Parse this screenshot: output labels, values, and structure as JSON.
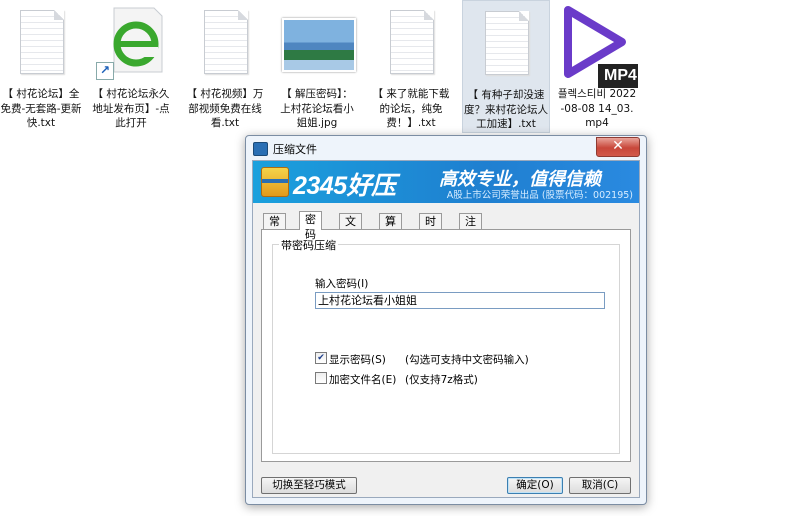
{
  "desktop": {
    "icons": [
      {
        "caption": "【 村花论坛】全免费-无套路-更新快.txt",
        "type": "text-file-icon"
      },
      {
        "caption": "【 村花论坛永久地址发布页】-点此打开",
        "type": "shortcut-ie-icon"
      },
      {
        "caption": "【 村花视频】万部视频免费在线看.txt",
        "type": "text-file-icon"
      },
      {
        "caption": "【 解压密码】：上村花论坛看小姐姐.jpg",
        "type": "image-file-icon"
      },
      {
        "caption": "【 来了就能下载的论坛，纯免费！】.txt",
        "type": "text-file-icon"
      },
      {
        "caption": "【 有种子却没速度？来村花论坛人工加速】.txt",
        "type": "text-file-icon"
      },
      {
        "caption": "플렉스티비 2022-08-08 14_03.mp4",
        "type": "mp4-file-icon",
        "badge": "MP4"
      }
    ]
  },
  "dialog": {
    "title": "压缩文件",
    "close_glyph": "✕",
    "banner": {
      "brand": "2345好压",
      "slogan": "高效专业，值得信赖",
      "subslogan": "A股上市公司荣誉出品 (股票代码：002195)"
    },
    "tabs": [
      "常规",
      "密码",
      "文件",
      "算法",
      "时间",
      "注释"
    ],
    "active_tab": "密码",
    "group_title": "带密码压缩",
    "password_label": "输入密码(I)",
    "password_value": "上村花论坛看小姐姐",
    "show_password": {
      "label": "显示密码(S)",
      "hint": "(勾选可支持中文密码输入)",
      "checked": true
    },
    "encrypt_names": {
      "label": "加密文件名(E)",
      "hint": "(仅支持7z格式)",
      "checked": false
    },
    "buttons": {
      "switch_mode": "切换至轻巧模式",
      "ok": "确定(O)",
      "cancel": "取消(C)"
    }
  },
  "colors": {
    "banner": "#1f7fd0",
    "close": "#c8473a",
    "mp4_purple": "#6a3bc9"
  }
}
